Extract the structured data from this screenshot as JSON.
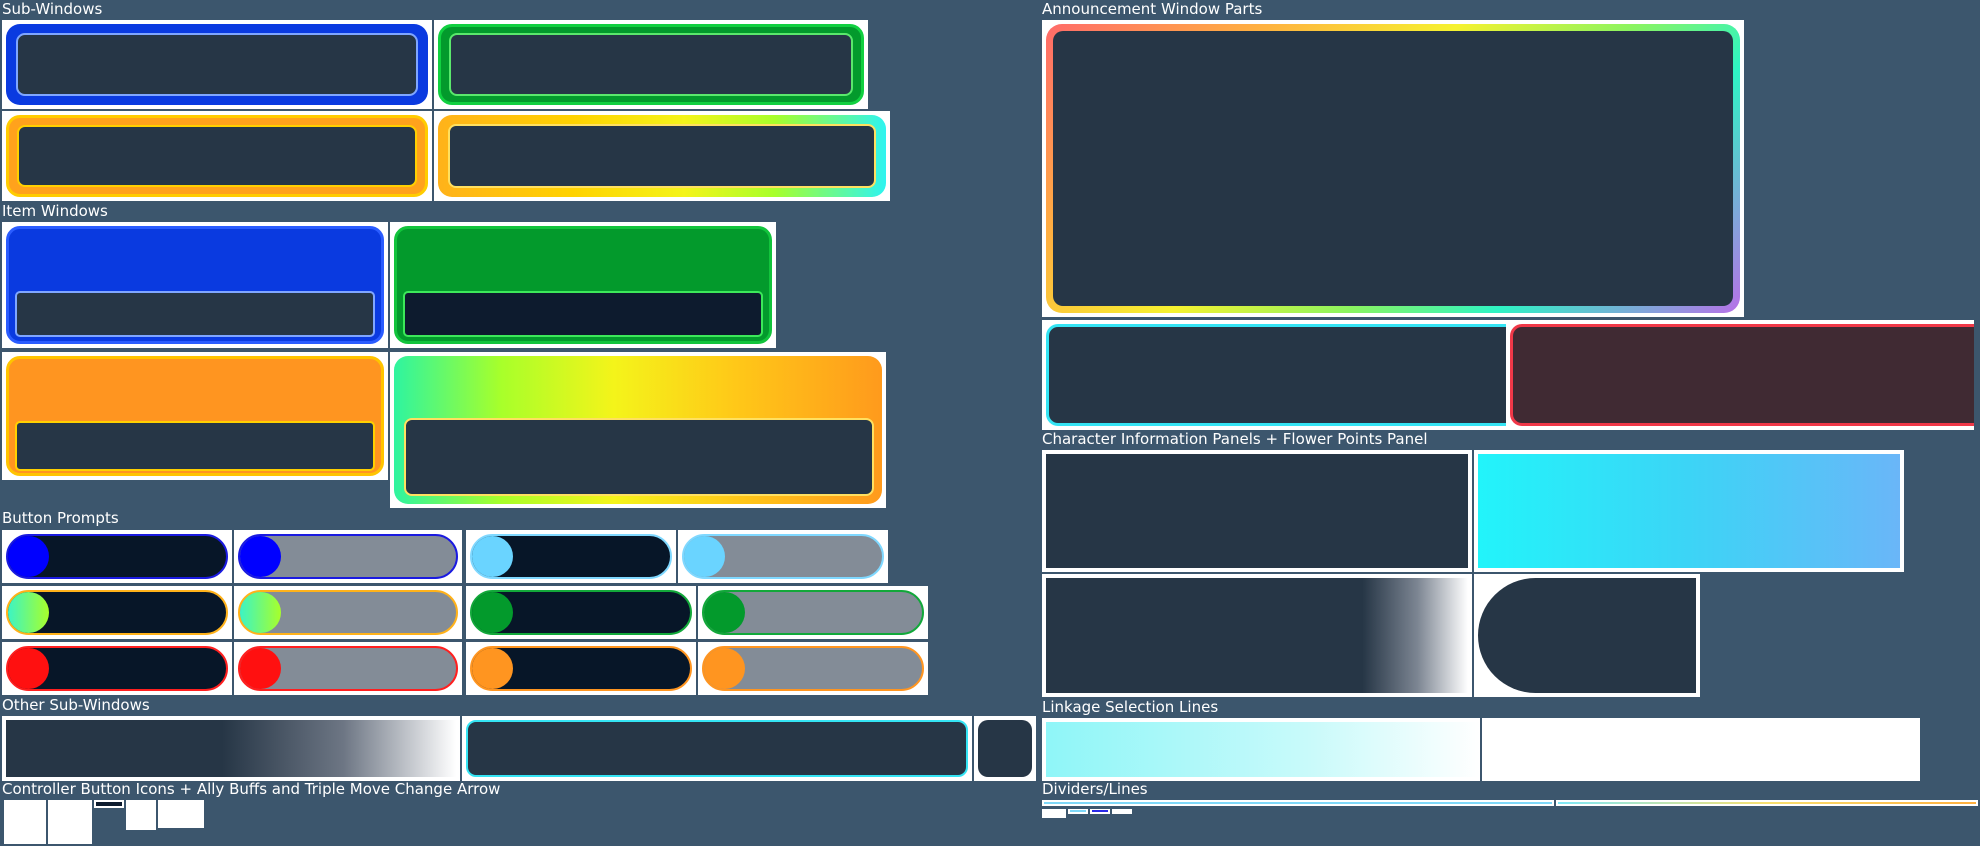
{
  "sections": {
    "sub_windows": "Sub-Windows",
    "item_windows": "Item Windows",
    "button_prompts": "Button Prompts",
    "other_sub_windows": "Other Sub-Windows",
    "controller_icons": "Controller Button Icons + Ally Buffs and Triple Move Change Arrow",
    "announcement_parts": "Announcement Window Parts",
    "character_panels": "Character Information Panels +  Flower Points Panel",
    "linkage_lines": "Linkage Selection Lines",
    "dividers": "Dividers/Lines"
  },
  "colors": {
    "background": "#3c566d",
    "panel_dark": "#263646",
    "panel_navy": "#0d1b2e",
    "blue": "#0a3ae0",
    "green": "#039a2c",
    "orange": "#ff9520",
    "yellow": "#f5c400",
    "cyan": "#34e4f4",
    "red": "#ff1f1f",
    "maroon": "#402a33"
  }
}
